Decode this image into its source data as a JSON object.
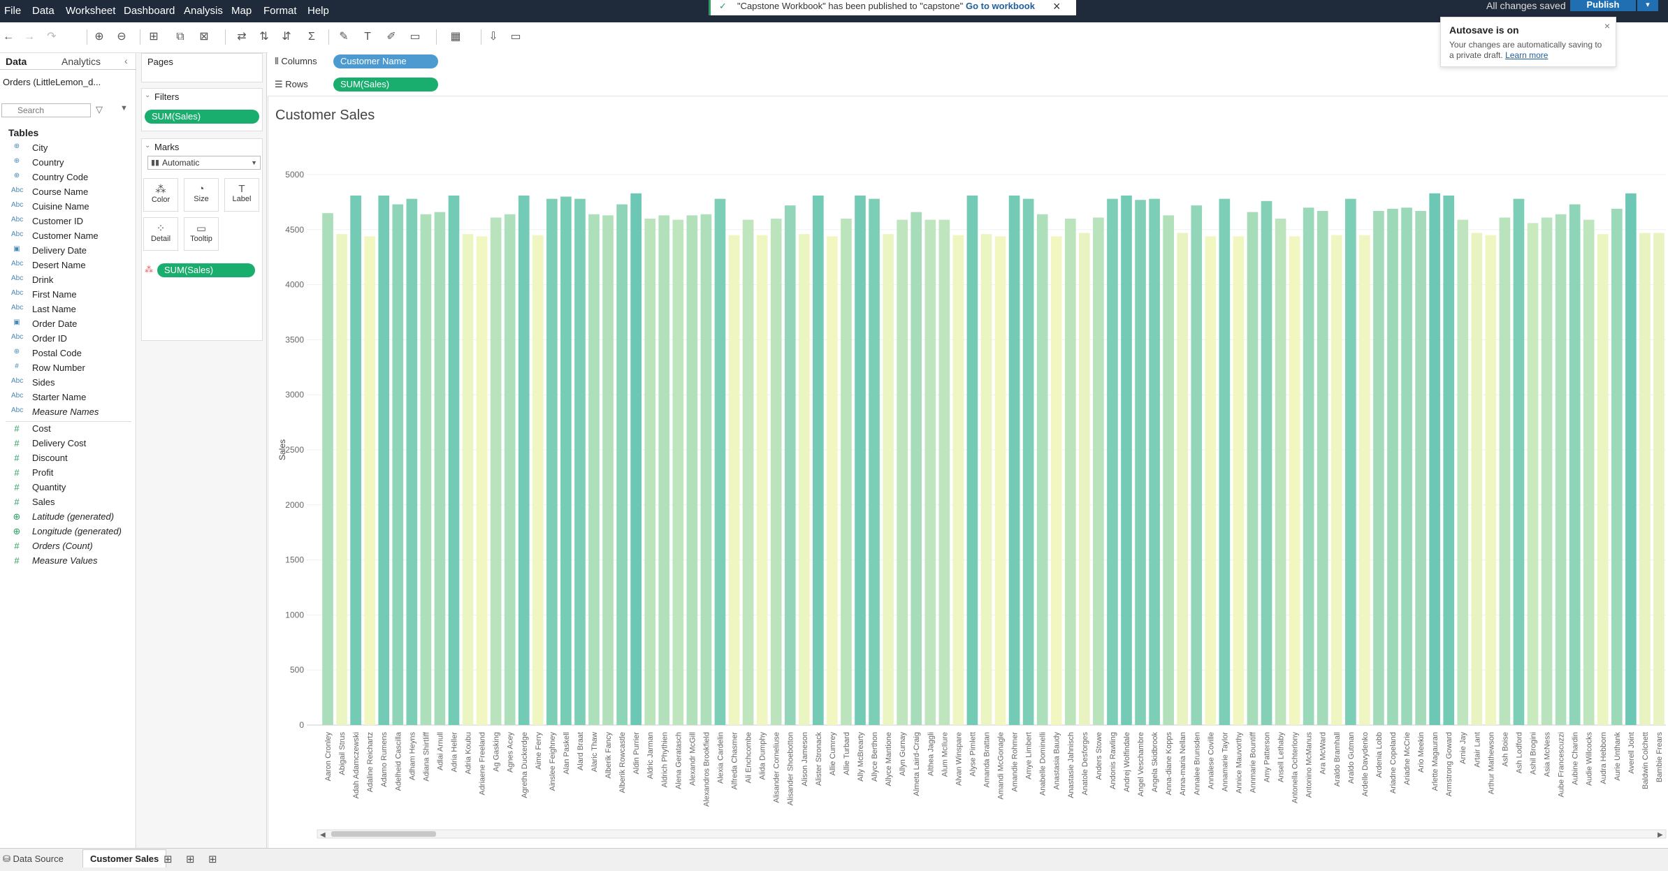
{
  "menubar": {
    "items": [
      "File",
      "Data",
      "Worksheet",
      "Dashboard",
      "Analysis",
      "Map",
      "Format",
      "Help"
    ],
    "toast_message": "\"Capstone Workbook\" has been published to \"capstone\"",
    "toast_link": "Go to workbook",
    "saved_status": "All changes saved",
    "publish_label": "Publish"
  },
  "autosave": {
    "title": "Autosave is on",
    "body": "Your changes are automatically saving to a private draft.",
    "link": "Learn more"
  },
  "data_pane": {
    "tab_data": "Data",
    "tab_analytics": "Analytics",
    "datasource": "Orders (LittleLemon_d...",
    "search_placeholder": "Search",
    "tables_label": "Tables",
    "dimensions": [
      {
        "icon": "globe-icon",
        "label": "City"
      },
      {
        "icon": "globe-icon",
        "label": "Country"
      },
      {
        "icon": "globe-icon",
        "label": "Country Code"
      },
      {
        "icon": "abc-icon",
        "label": "Course Name"
      },
      {
        "icon": "abc-icon",
        "label": "Cuisine Name"
      },
      {
        "icon": "abc-icon",
        "label": "Customer ID"
      },
      {
        "icon": "abc-icon",
        "label": "Customer Name"
      },
      {
        "icon": "calendar-icon",
        "label": "Delivery Date"
      },
      {
        "icon": "abc-icon",
        "label": "Desert Name"
      },
      {
        "icon": "abc-icon",
        "label": "Drink"
      },
      {
        "icon": "abc-icon",
        "label": "First Name"
      },
      {
        "icon": "abc-icon",
        "label": "Last Name"
      },
      {
        "icon": "calendar-icon",
        "label": "Order Date"
      },
      {
        "icon": "abc-icon",
        "label": "Order ID"
      },
      {
        "icon": "globe-icon",
        "label": "Postal Code"
      },
      {
        "icon": "hash-icon",
        "label": "Row Number"
      },
      {
        "icon": "abc-icon",
        "label": "Sides"
      },
      {
        "icon": "abc-icon",
        "label": "Starter Name"
      },
      {
        "icon": "abc-icon",
        "label": "Measure Names",
        "italic": true
      }
    ],
    "measures": [
      {
        "icon": "hash-icon",
        "label": "Cost"
      },
      {
        "icon": "hash-icon",
        "label": "Delivery Cost"
      },
      {
        "icon": "hash-icon",
        "label": "Discount"
      },
      {
        "icon": "hash-icon",
        "label": "Profit"
      },
      {
        "icon": "hash-icon",
        "label": "Quantity"
      },
      {
        "icon": "hash-icon",
        "label": "Sales"
      },
      {
        "icon": "globe-icon",
        "label": "Latitude (generated)",
        "italic": true
      },
      {
        "icon": "globe-icon",
        "label": "Longitude (generated)",
        "italic": true
      },
      {
        "icon": "hash-icon",
        "label": "Orders (Count)",
        "italic": true
      },
      {
        "icon": "hash-icon",
        "label": "Measure Values",
        "italic": true
      }
    ]
  },
  "cards": {
    "pages_title": "Pages",
    "filters_title": "Filters",
    "filter_pill": "SUM(Sales)",
    "marks_title": "Marks",
    "marks_type": "Automatic",
    "mark_buttons": [
      "Color",
      "Size",
      "Label",
      "Detail",
      "Tooltip"
    ],
    "color_pill": "SUM(Sales)"
  },
  "shelves": {
    "columns_label": "Columns",
    "columns_pill": "Customer Name",
    "rows_label": "Rows",
    "rows_pill": "SUM(Sales)"
  },
  "bottom": {
    "datasource_tab": "Data Source",
    "sheet_tab": "Customer Sales"
  },
  "colors": {
    "accent_green": "#1aae6e",
    "pill_blue": "#4c9ad0",
    "bar_low": "#f2f7c2",
    "bar_high": "#6cc8b4"
  },
  "chart_data": {
    "type": "bar",
    "title": "Customer Sales",
    "ylabel": "Sales",
    "xlabel": "",
    "ylim": [
      0,
      5000
    ],
    "yticks": [
      0,
      500,
      1000,
      1500,
      2000,
      2500,
      3000,
      3500,
      4000,
      4500,
      5000
    ],
    "grid": true,
    "categories": [
      "Aaron Cronley",
      "Abigail Strus",
      "Adah Adamczewski",
      "Adaline Reichartz",
      "Adamo Rumens",
      "Adelheid Cascilla",
      "Adham Heyns",
      "Adiana Shirtliff",
      "Adlai Arnull",
      "Adria Heller",
      "Adria Koubu",
      "Adriaene Freeland",
      "Ag Gasking",
      "Agnes Acey",
      "Agretha Duckerdge",
      "Aime Ferry",
      "Ainslee Feighney",
      "Alan Paskell",
      "Alard Braat",
      "Alaric Thaw",
      "Alberik Fancy",
      "Alberik Rowcastle",
      "Aldin Purrier",
      "Aldric Jarman",
      "Aldrich Phythien",
      "Alena Geratasch",
      "Alexandr McGill",
      "Alexandros Brookfield",
      "Alexia Cardelin",
      "Alfreda Chasmer",
      "Ali Enchcombe",
      "Alida Dumphy",
      "Alisander Corneliuse",
      "Alisander Shoebotton",
      "Alison Jameson",
      "Alister Stronack",
      "Allie Cumrey",
      "Allie Turbard",
      "Ally McBrearty",
      "Allyce Berthon",
      "Allyce Mantione",
      "Allyn Gurnay",
      "Almeta Laird-Craig",
      "Althea Jaggli",
      "Alum McIlure",
      "Alvan Winspare",
      "Alyse Pimlett",
      "Amanda Brattan",
      "Amandi McGonagle",
      "Amandie Rohmer",
      "Amye Limbert",
      "Anabelle Dominelli",
      "Anastasia Baudy",
      "Anastasie Jahnisch",
      "Anatole Desforges",
      "Anders Stowe",
      "Andonis Rawling",
      "Andrej Wolfindale",
      "Angel Veschambre",
      "Angela Skidbrook",
      "Anna-diane Kopps",
      "Anna-maria Nellan",
      "Annalee Brunsden",
      "Annalese Coville",
      "Annamarie Taylor",
      "Annice Mauvorthy",
      "Annmarie Bountiff",
      "Amy Patterson",
      "Ansell Lethaby",
      "Antonella Ochterlony",
      "Antonino McManus",
      "Ara McWard",
      "Araldo Bramhall",
      "Araldo Gutman",
      "Ardelle Davydenko",
      "Ardenia Lobb",
      "Ariadne Copeland",
      "Ariadne McCrie",
      "Ario Meekin",
      "Arlette Magauran",
      "Armstrong Goward",
      "Arnie Jay",
      "Artair Lant",
      "Arthur Mathewson",
      "Ash Boise",
      "Ash Lodford",
      "Ashil Brogini",
      "Asia McNess",
      "Aube Francescuzzi",
      "Aubine Chardin",
      "Audie Willcocks",
      "Audra Hebborn",
      "Aurie Unthank",
      "Averell Joint",
      "Baldwin Colchett",
      "Bambie Frears"
    ],
    "values": [
      4650,
      4460,
      4810,
      4440,
      4810,
      4730,
      4780,
      4640,
      4660,
      4810,
      4460,
      4440,
      4610,
      4640,
      4810,
      4450,
      4780,
      4800,
      4780,
      4640,
      4630,
      4730,
      4830,
      4600,
      4630,
      4590,
      4630,
      4640,
      4780,
      4450,
      4590,
      4450,
      4600,
      4720,
      4460,
      4810,
      4440,
      4600,
      4810,
      4780,
      4460,
      4590,
      4660,
      4590,
      4590,
      4450,
      4810,
      4460,
      4440,
      4810,
      4780,
      4640,
      4440,
      4600,
      4470,
      4610,
      4780,
      4810,
      4770,
      4780,
      4630,
      4470,
      4720,
      4440,
      4780,
      4440,
      4660,
      4760,
      4600,
      4440,
      4700,
      4670,
      4450,
      4780,
      4450,
      4670,
      4690,
      4700,
      4670,
      4830,
      4810,
      4590,
      4470,
      4450,
      4610,
      4780,
      4560,
      4610,
      4640,
      4730,
      4590,
      4460,
      4690,
      4830,
      4470,
      4470
    ]
  }
}
